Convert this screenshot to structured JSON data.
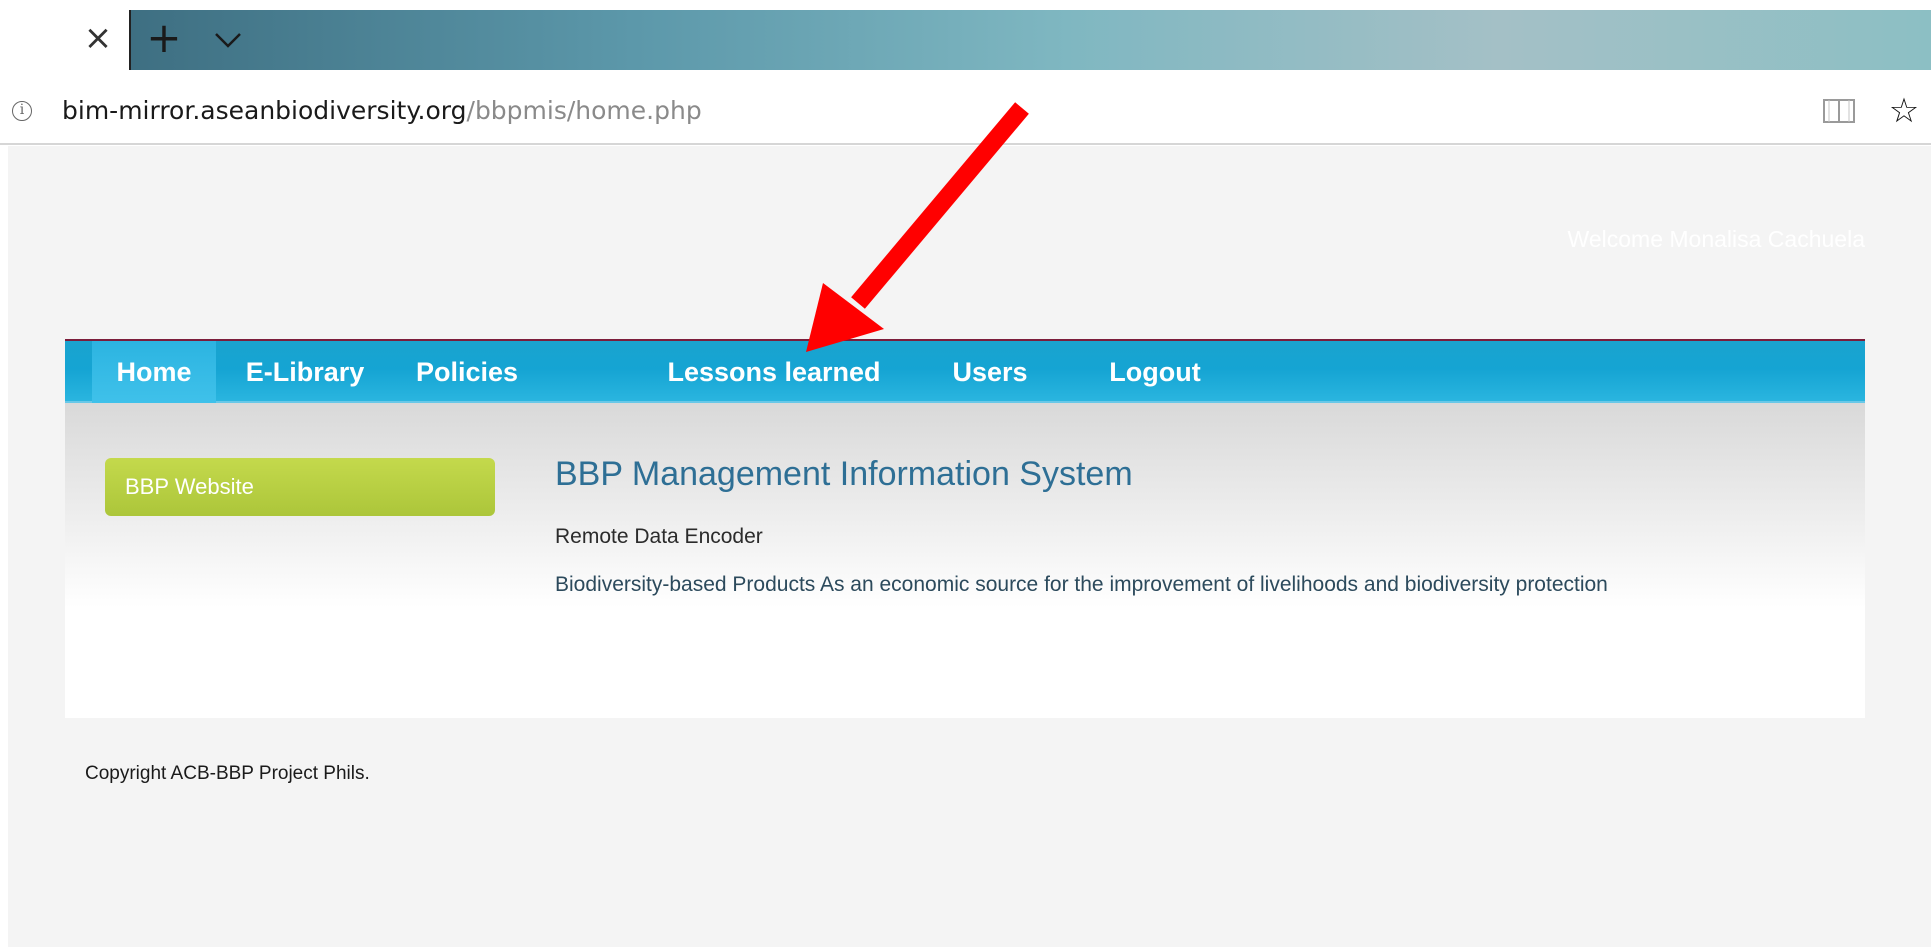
{
  "browser": {
    "url_domain": "bim-mirror.aseanbiodiversity.org",
    "url_path": "/bbpmis/home.php",
    "tab_close_glyph": "×",
    "new_tab_glyph": "+",
    "favorite_glyph": "☆",
    "info_glyph": "i",
    "colors": {
      "tabstrip_gradient_start": "#3e6f82",
      "tabstrip_gradient_end": "#8cbfc4"
    }
  },
  "page": {
    "welcome_text": "Welcome Monalisa Cachuela",
    "nav": {
      "items": [
        {
          "label": "Home",
          "active": true
        },
        {
          "label": "E-Library"
        },
        {
          "label": "Policies"
        },
        {
          "label": "Lessons learned"
        },
        {
          "label": "Users"
        },
        {
          "label": "Logout"
        }
      ]
    },
    "sidebar_button": "BBP Website",
    "title": "BBP Management Information System",
    "subtitle": "Remote Data Encoder",
    "description": "Biodiversity-based Products As an economic source for the improvement of livelihoods and biodiversity protection",
    "copyright": "Copyright ACB-BBP Project Phils.",
    "colors": {
      "nav_blue": "#15a4d3",
      "button_green": "#b5ce42",
      "title_blue": "#2e6f95",
      "annotation_arrow": "#ff0000"
    }
  },
  "icons": {
    "info": "info-icon",
    "close": "close-icon",
    "new_tab": "plus-icon",
    "tab_list": "chevron-down-icon",
    "reading_view": "book-icon",
    "favorite": "star-icon",
    "annotation": "red-arrow-icon"
  }
}
